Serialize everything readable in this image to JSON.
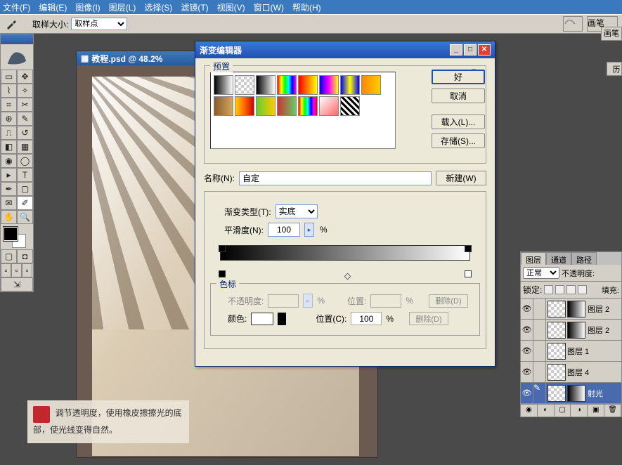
{
  "menu": [
    "文件(F)",
    "编辑(E)",
    "图像(I)",
    "图层(L)",
    "选择(S)",
    "滤镜(T)",
    "视图(V)",
    "窗口(W)",
    "帮助(H)"
  ],
  "options": {
    "sample_label": "取样大小:",
    "sample_value": "取样点",
    "brush_label": "画笔"
  },
  "doc": {
    "title": "教程.psd @ 48.2%"
  },
  "annotation": "调节透明度，使用橡皮擦擦光的底部，使光线变得自然。",
  "gradient_editor": {
    "title": "渐变编辑器",
    "presets_label": "预置",
    "ok": "好",
    "cancel": "取消",
    "load": "载入(L)...",
    "save": "存储(S)...",
    "name_label": "名称(N):",
    "name_value": "自定",
    "new_btn": "新建(W)",
    "type_label": "渐变类型(T):",
    "type_value": "实底",
    "smooth_label": "平滑度(N):",
    "smooth_value": "100",
    "stops_label": "色标",
    "opacity_label": "不透明度:",
    "position_label": "位置:",
    "position2_label": "位置(C):",
    "position2_value": "100",
    "color_label": "颜色:",
    "delete": "删除(D)",
    "pct": "%",
    "presets": [
      "linear-gradient(to right,#000,#fff)",
      "repeating-conic-gradient(#ccc 0 25%,#fff 0 50%) 0/8px 8px",
      "linear-gradient(to right,#000,#fff)",
      "linear-gradient(to right,#f00,#ff0,#0f0,#0ff,#00f,#f0f)",
      "linear-gradient(to right,#f00,#ff0)",
      "linear-gradient(to right,#00f,#f0f,#ff0)",
      "linear-gradient(to right,#00f,#ff0,#00f)",
      "linear-gradient(to right,#ff8800,#ffcc00)",
      "linear-gradient(to right,#8a5a2a,#d4a860)",
      "linear-gradient(to right,#ffcc00,#ff6600,#cc0000)",
      "linear-gradient(to right,#66cc33,#ffcc00)",
      "linear-gradient(to right,#cc3333,#66cc66)",
      "linear-gradient(to right,#f00,#ff0,#0f0,#0ff,#00f,#f0f,#f00)",
      "linear-gradient(to bottom right,#fff,#f66)",
      "repeating-linear-gradient(45deg,#000 0 3px,#fff 3px 6px)"
    ]
  },
  "chart_data": {
    "type": "gradient",
    "stops": [
      {
        "position": 0,
        "color": "#000000"
      },
      {
        "position": 100,
        "color": "#ffffff"
      }
    ],
    "opacity_stops": [
      {
        "position": 0,
        "opacity": 100
      },
      {
        "position": 100,
        "opacity": 100
      }
    ]
  },
  "layers": {
    "tabs": [
      "图层",
      "通道",
      "路径"
    ],
    "blend": "正常",
    "opacity_label": "不透明度:",
    "lock_label": "锁定:",
    "fill_label": "填充:",
    "items": [
      {
        "name": "图层 2",
        "mask": true
      },
      {
        "name": "图层 2",
        "mask": true
      },
      {
        "name": "图层 1",
        "mask": false
      },
      {
        "name": "图层 4",
        "mask": false
      },
      {
        "name": "射光",
        "mask": true,
        "active": true
      }
    ]
  },
  "right_tab": "历"
}
